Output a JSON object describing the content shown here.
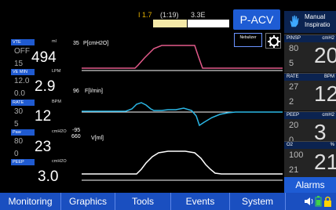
{
  "top": {
    "indicator": "I 1.7",
    "time": "(1:19)",
    "value": "3.3E",
    "mode": "P-ACV"
  },
  "colors": {
    "accent": "#1e5cd4",
    "header_navy": "#0b2350",
    "pressure_wave": "#e25a8a",
    "flow_wave": "#2bb7e6",
    "volume_wave": "#ffffff"
  },
  "params": [
    {
      "label": "VTE",
      "unit": "ml",
      "hi": "OFF",
      "lo": "15",
      "value": "494"
    },
    {
      "label": "VE MIN",
      "unit": "LPM",
      "hi": "12.0",
      "lo": "0.0",
      "value": "2.9"
    },
    {
      "label": "RATE",
      "unit": "BPM",
      "hi": "30",
      "lo": "5",
      "value": "12"
    },
    {
      "label": "Paw",
      "unit": "cmH2O",
      "hi": "80",
      "lo": "0",
      "value": "23"
    },
    {
      "label": "PEEP",
      "unit": "cmH2O",
      "hi": "",
      "lo": "",
      "value": "3.0"
    }
  ],
  "graphs": {
    "pressure": {
      "scale": "35",
      "title": "P[cmH2O]"
    },
    "flow": {
      "scale": "96",
      "title": "F[l/min]",
      "scale_neg": "-95"
    },
    "volume": {
      "scale": "660",
      "title": "V[ml]"
    }
  },
  "buttons": {
    "nebulizer": "Nebulizer",
    "manual_line1": "Manual",
    "manual_line2": "Inspiratio",
    "alarms": "Alarms"
  },
  "settings": [
    {
      "label": "PINSP",
      "unit": "cmH2",
      "hi": "80",
      "lo": "5",
      "value": "20"
    },
    {
      "label": "RATE",
      "unit": "BPM",
      "hi": "27",
      "lo": "2",
      "value": "12"
    },
    {
      "label": "PEEP",
      "unit": "cmH2",
      "hi": "20",
      "lo": "0",
      "value": "3"
    },
    {
      "label": "O2",
      "unit": "%",
      "hi": "100",
      "lo": "21",
      "value": "21"
    }
  ],
  "nav": [
    "Monitoring",
    "Graphics",
    "Tools",
    "Events",
    "System"
  ]
}
